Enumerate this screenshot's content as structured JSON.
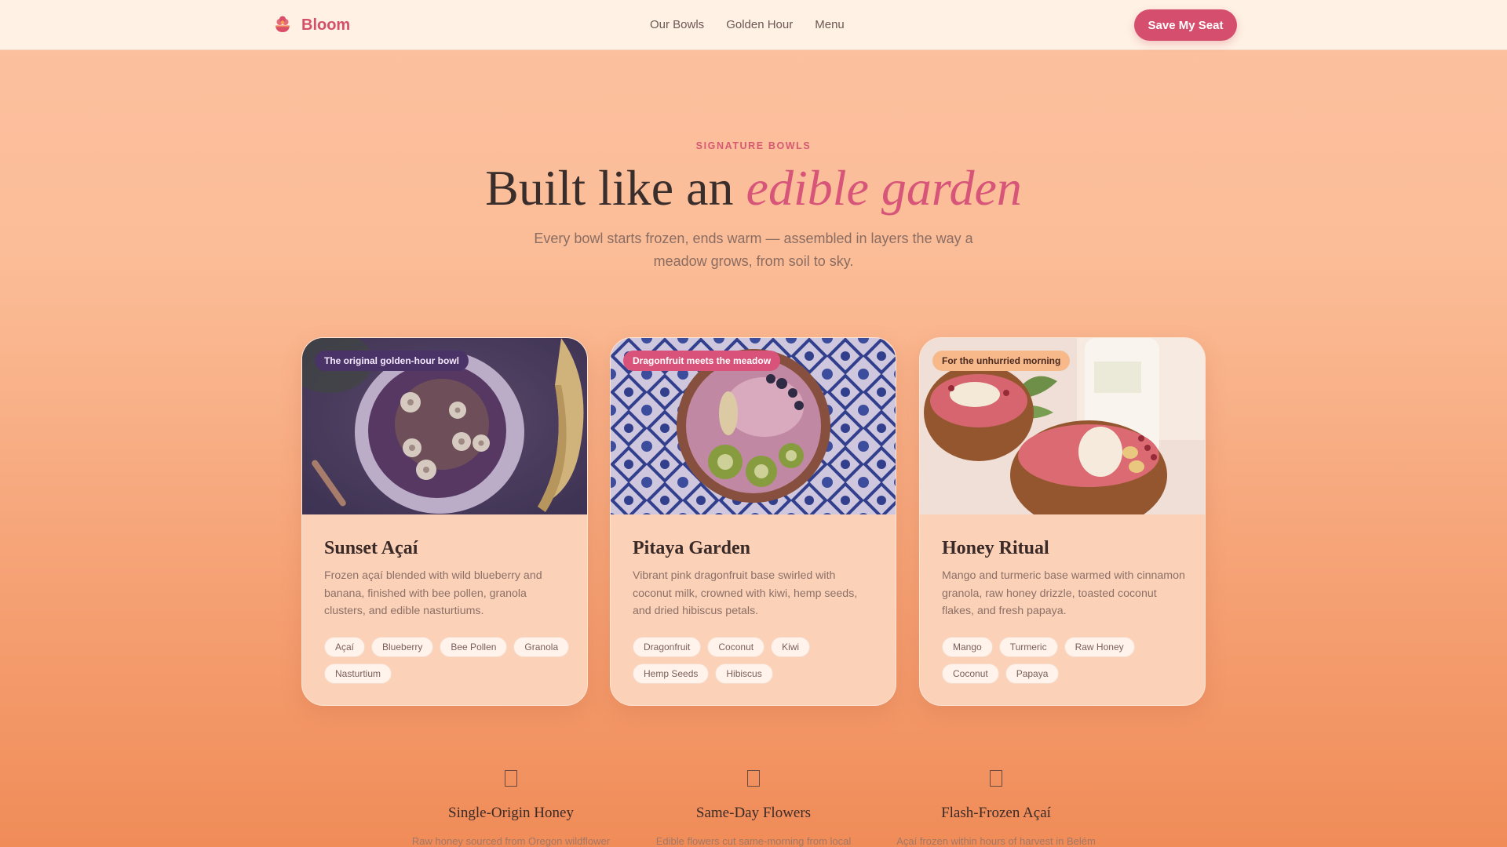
{
  "nav": {
    "brand": "Bloom",
    "links": [
      "Our Bowls",
      "Golden Hour",
      "Menu"
    ],
    "cta": "Save My Seat"
  },
  "hero": {
    "eyebrow": "SIGNATURE BOWLS",
    "headline_plain": "Built like an ",
    "headline_accent": "edible garden",
    "subtext": "Every bowl starts frozen, ends warm — assembled in layers the way a meadow grows, from soil to sky."
  },
  "cards": [
    {
      "tag": "The original golden-hour bowl",
      "title": "Sunset Açaí",
      "desc": "Frozen açaí blended with wild blueberry and banana, finished with bee pollen, granola clusters, and edible nasturtiums.",
      "chips": [
        "Açaí",
        "Blueberry",
        "Bee Pollen",
        "Granola",
        "Nasturtium"
      ]
    },
    {
      "tag": "Dragonfruit meets the meadow",
      "title": "Pitaya Garden",
      "desc": "Vibrant pink dragonfruit base swirled with coconut milk, crowned with kiwi, hemp seeds, and dried hibiscus petals.",
      "chips": [
        "Dragonfruit",
        "Coconut",
        "Kiwi",
        "Hemp Seeds",
        "Hibiscus"
      ]
    },
    {
      "tag": "For the unhurried morning",
      "title": "Honey Ritual",
      "desc": "Mango and turmeric base warmed with cinnamon granola, raw honey drizzle, toasted coconut flakes, and fresh papaya.",
      "chips": [
        "Mango",
        "Turmeric",
        "Raw Honey",
        "Coconut",
        "Papaya"
      ]
    }
  ],
  "features": [
    {
      "title": "Single-Origin Honey",
      "desc": "Raw honey sourced from Oregon wildflower"
    },
    {
      "title": "Same-Day Flowers",
      "desc": "Edible flowers cut same-morning from local"
    },
    {
      "title": "Flash-Frozen Açaí",
      "desc": "Açaí frozen within hours of harvest in Belém"
    }
  ],
  "colors": {
    "accent": "#d64e6d",
    "brand": "#d4506a",
    "card_bg": "#fbd1b7"
  }
}
